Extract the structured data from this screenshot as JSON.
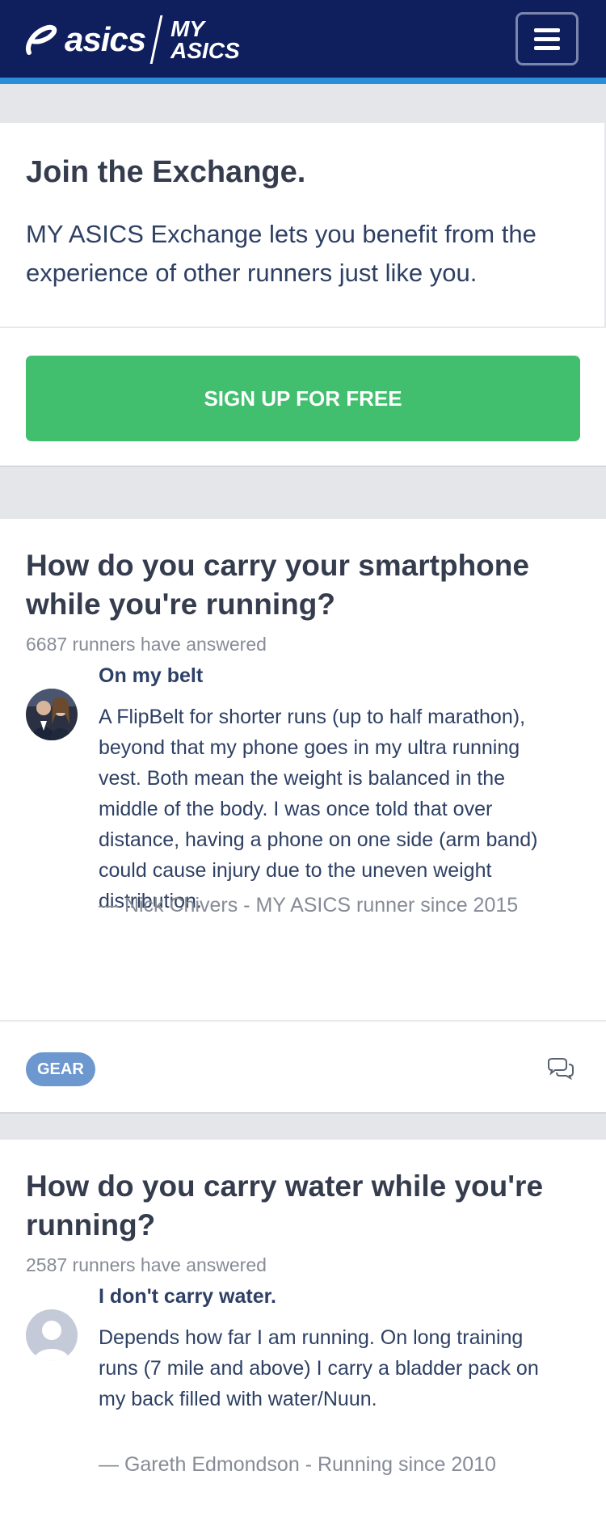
{
  "header": {
    "brand": "asics",
    "sub_line1": "MY",
    "sub_line2": "ASICS",
    "menu_icon": "hamburger-menu-icon"
  },
  "join": {
    "title": "Join the Exchange.",
    "text": "MY ASICS Exchange lets you benefit from the experience of other runners just like you.",
    "signup_label": "SIGN UP FOR FREE"
  },
  "questions": [
    {
      "title": "How do you carry your smartphone while you're running?",
      "count": "6687 runners have answered",
      "answer_head": "On my belt",
      "answer_body": "A FlipBelt for shorter runs (up to half marathon), beyond that my phone goes in my ultra running vest. Both mean the weight is balanced in the middle of the body. I was once told that over distance, having a phone on one side (arm band) could cause injury due to the uneven weight distribution.",
      "answer_by": "— Nick Chivers - MY ASICS runner since 2015",
      "tag": "GEAR"
    },
    {
      "title": "How do you carry water while you're running?",
      "count": "2587 runners have answered",
      "answer_head": "I don't carry water.",
      "answer_body": "Depends how far I am running. On long training runs (7 mile and above) I carry a bladder pack on my back filled with water/Nuun.",
      "answer_by": "— Gareth Edmondson - Running since 2010"
    }
  ],
  "colors": {
    "header_bg": "#0f1e5c",
    "header_stripe": "#2a8fd8",
    "signup_green": "#41be6e",
    "tag_blue": "#6c97cf"
  }
}
